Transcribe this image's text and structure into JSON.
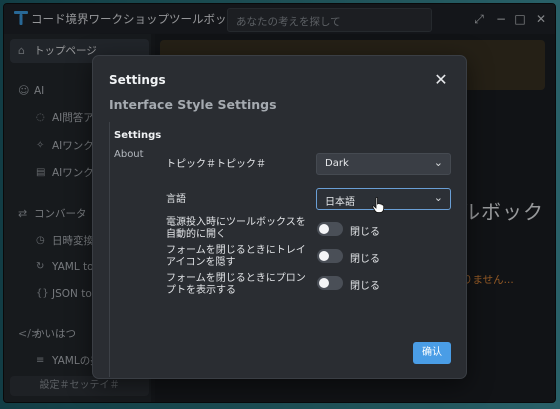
{
  "app": {
    "title": "コード境界ワークショップツールボックス",
    "search_placeholder": "あなたの考えを探して",
    "accent_color": "#4a9de6"
  },
  "window_controls": {
    "expand": "⤢",
    "minimize": "−",
    "maximize": "□",
    "close": "✕"
  },
  "sidebar": {
    "home": "トップページ",
    "sections": [
      {
        "label": "AI",
        "items": [
          "AI問答アシ",
          "AIワンクリ",
          "AIワンクリ"
        ]
      },
      {
        "label": "コンバータ",
        "items": [
          "日時変換器",
          "YAML to J",
          "JSON to Y"
        ]
      },
      {
        "label": "かいはつ",
        "items": [
          "YAMLの美"
        ]
      }
    ],
    "footer": "設定＃セッテイ＃"
  },
  "background": {
    "heading": "ルボック",
    "warning": "りません..."
  },
  "dialog": {
    "title": "Settings",
    "subtitle": "Interface Style Settings",
    "tabs": [
      "Settings",
      "About"
    ],
    "close": "✕",
    "theme": {
      "label": "トピック＃トピック＃",
      "value": "Dark"
    },
    "language": {
      "label": "言語",
      "value": "日本語"
    },
    "toggles": [
      {
        "label": "電源投入時にツールボックスを自動的に開く",
        "state": "閉じる",
        "on": false
      },
      {
        "label": "フォームを閉じるときにトレイアイコンを隠す",
        "state": "閉じる",
        "on": false
      },
      {
        "label": "フォームを閉じるときにプロンプトを表示する",
        "state": "閉じる",
        "on": false
      }
    ],
    "ok": "确认"
  }
}
